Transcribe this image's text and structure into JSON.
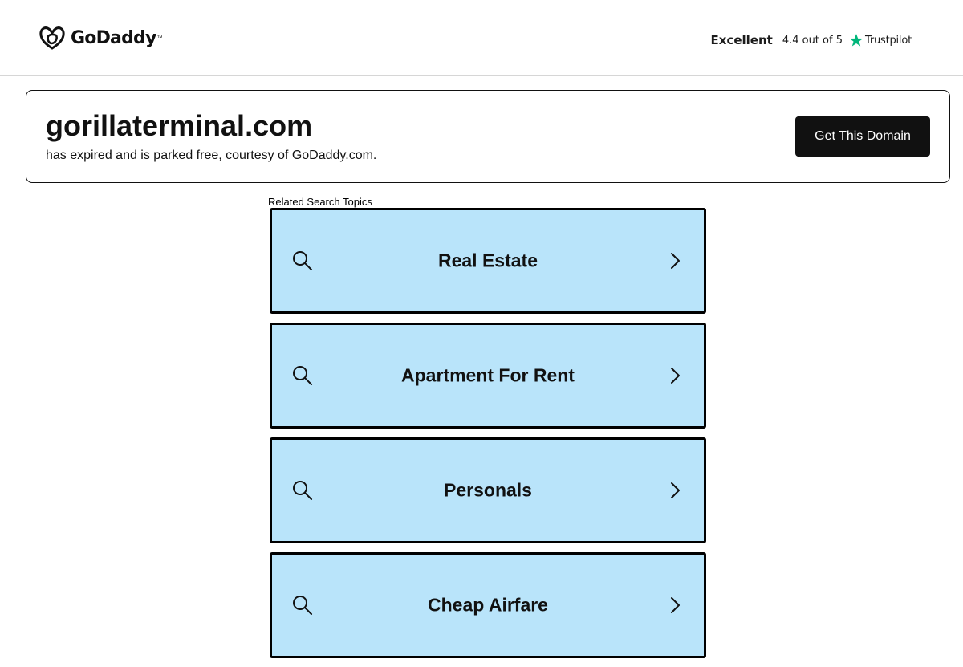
{
  "header": {
    "logo_text": "GoDaddy",
    "logo_tm": "™",
    "trustpilot": {
      "rating_word": "Excellent",
      "rating_text": "4.4 out of 5",
      "brand": "Trustpilot",
      "star_color": "#00b67a"
    }
  },
  "domain": {
    "name": "gorillaterminal.com",
    "subtitle": "has expired and is parked free, courtesy of GoDaddy.com.",
    "cta_label": "Get This Domain"
  },
  "topics": {
    "heading": "Related Search Topics",
    "tile_color": "#b9e4fa",
    "items": [
      {
        "label": "Real Estate",
        "icon": "search-icon",
        "arrow": "chevron-right-icon"
      },
      {
        "label": "Apartment For Rent",
        "icon": "search-icon",
        "arrow": "chevron-right-icon"
      },
      {
        "label": "Personals",
        "icon": "search-icon",
        "arrow": "chevron-right-icon"
      },
      {
        "label": "Cheap Airfare",
        "icon": "search-icon",
        "arrow": "chevron-right-icon"
      }
    ]
  }
}
